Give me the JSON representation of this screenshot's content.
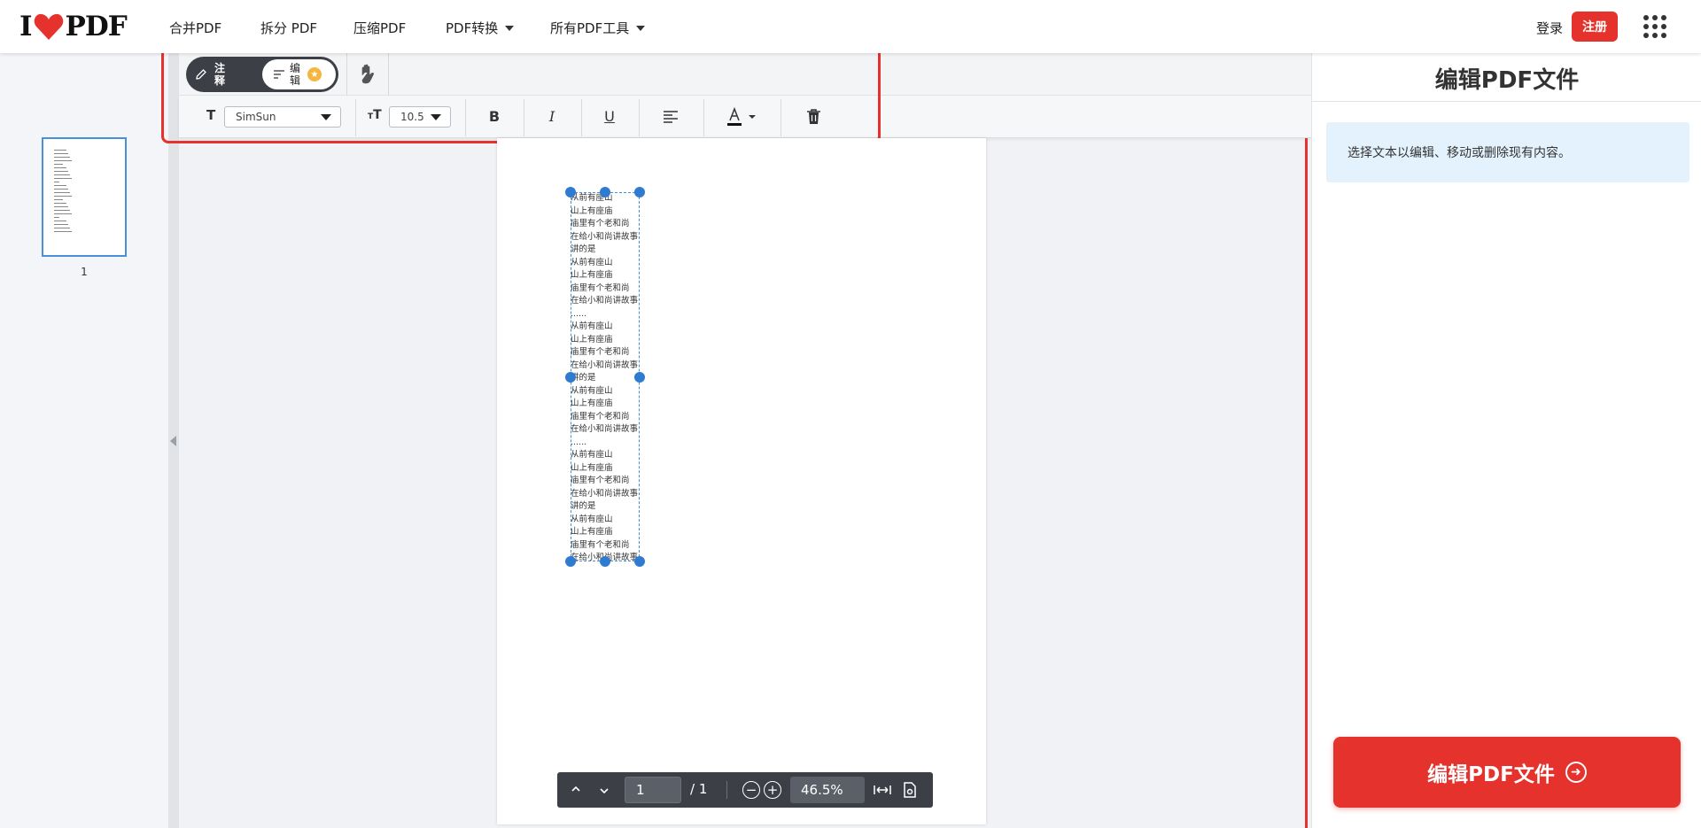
{
  "brand": {
    "logo_left": "I",
    "logo_right": "PDF"
  },
  "nav": {
    "items": [
      {
        "label": "合并PDF"
      },
      {
        "label": "拆分 PDF"
      },
      {
        "label": "压缩PDF"
      },
      {
        "label": "PDF转换"
      },
      {
        "label": "所有PDF工具"
      }
    ],
    "login": "登录",
    "signup": "注册"
  },
  "thumbnails": {
    "page_number": "1"
  },
  "mode": {
    "annotate": "注释",
    "edit": "编辑"
  },
  "format": {
    "font_family": "SimSun",
    "font_size": "10.5",
    "bold": "B",
    "italic": "I",
    "underline": "U"
  },
  "page_text": [
    "从前有座山",
    "山上有座庙",
    "庙里有个老和尚",
    "在给小和尚讲故事",
    "讲的是",
    "从前有座山",
    "山上有座庙",
    "庙里有个老和尚",
    "在给小和尚讲故事",
    "......",
    "从前有座山",
    "山上有座庙",
    "庙里有个老和尚",
    "在给小和尚讲故事",
    "讲的是",
    "从前有座山",
    "山上有座庙",
    "庙里有个老和尚",
    "在给小和尚讲故事",
    "......",
    "从前有座山",
    "山上有座庙",
    "庙里有个老和尚",
    "在给小和尚讲故事",
    "讲的是",
    "从前有座山",
    "山上有座庙",
    "庙里有个老和尚",
    "在给小和尚讲故事"
  ],
  "pager": {
    "current_page": "1",
    "total": "/ 1",
    "zoom": "46.5%"
  },
  "right_panel": {
    "title": "编辑PDF文件",
    "info": "选择文本以编辑、移动或删除现有内容。",
    "action": "编辑PDF文件"
  },
  "colors": {
    "brand_red": "#e5322d",
    "dark_bar": "#3c3f46",
    "info_bg": "#e3f2fc",
    "accent_blue": "#2f7bd0"
  }
}
